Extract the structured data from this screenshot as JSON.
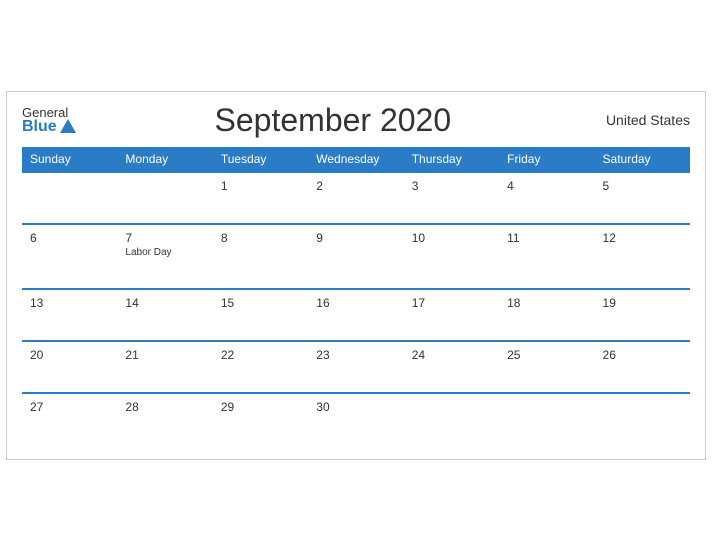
{
  "header": {
    "logo_general": "General",
    "logo_blue": "Blue",
    "title": "September 2020",
    "country": "United States"
  },
  "weekdays": [
    "Sunday",
    "Monday",
    "Tuesday",
    "Wednesday",
    "Thursday",
    "Friday",
    "Saturday"
  ],
  "weeks": [
    [
      {
        "day": "",
        "event": ""
      },
      {
        "day": "",
        "event": ""
      },
      {
        "day": "1",
        "event": ""
      },
      {
        "day": "2",
        "event": ""
      },
      {
        "day": "3",
        "event": ""
      },
      {
        "day": "4",
        "event": ""
      },
      {
        "day": "5",
        "event": ""
      }
    ],
    [
      {
        "day": "6",
        "event": ""
      },
      {
        "day": "7",
        "event": "Labor Day"
      },
      {
        "day": "8",
        "event": ""
      },
      {
        "day": "9",
        "event": ""
      },
      {
        "day": "10",
        "event": ""
      },
      {
        "day": "11",
        "event": ""
      },
      {
        "day": "12",
        "event": ""
      }
    ],
    [
      {
        "day": "13",
        "event": ""
      },
      {
        "day": "14",
        "event": ""
      },
      {
        "day": "15",
        "event": ""
      },
      {
        "day": "16",
        "event": ""
      },
      {
        "day": "17",
        "event": ""
      },
      {
        "day": "18",
        "event": ""
      },
      {
        "day": "19",
        "event": ""
      }
    ],
    [
      {
        "day": "20",
        "event": ""
      },
      {
        "day": "21",
        "event": ""
      },
      {
        "day": "22",
        "event": ""
      },
      {
        "day": "23",
        "event": ""
      },
      {
        "day": "24",
        "event": ""
      },
      {
        "day": "25",
        "event": ""
      },
      {
        "day": "26",
        "event": ""
      }
    ],
    [
      {
        "day": "27",
        "event": ""
      },
      {
        "day": "28",
        "event": ""
      },
      {
        "day": "29",
        "event": ""
      },
      {
        "day": "30",
        "event": ""
      },
      {
        "day": "",
        "event": ""
      },
      {
        "day": "",
        "event": ""
      },
      {
        "day": "",
        "event": ""
      }
    ]
  ]
}
